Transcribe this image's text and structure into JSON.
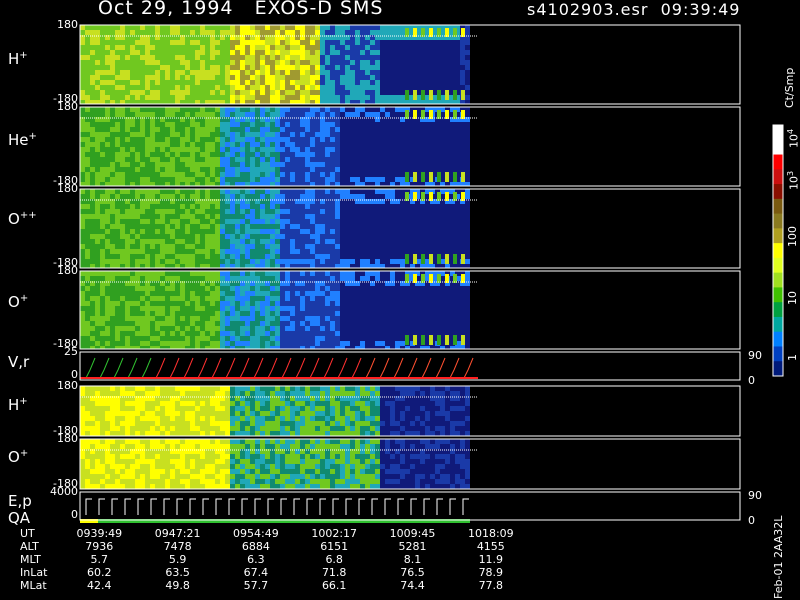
{
  "header": {
    "date_mission": "Oct 29, 1994   EXOS-D SMS",
    "file_time": "s4102903.esr  09:39:49"
  },
  "colorbar": {
    "unit_label": "Ct/Smp",
    "ticks": [
      "10",
      "10",
      "100",
      "10",
      "1"
    ],
    "tick_exponents": [
      "4",
      "3",
      "",
      "",
      ""
    ],
    "colors": [
      "#ffffff",
      "#ffffff",
      "#ff0000",
      "#cc1010",
      "#8a0f00",
      "#7a5a10",
      "#8a7a20",
      "#b0a020",
      "#ffff00",
      "#e0ff20",
      "#a0e020",
      "#40c000",
      "#00a040",
      "#00a8a0",
      "#0080ff",
      "#0040c0",
      "#001a7a"
    ]
  },
  "chart_data": {
    "type": "heatmap",
    "title": "Oct 29, 1994   EXOS-D SMS",
    "x_label": "UT",
    "panels": [
      {
        "name": "H+",
        "ylim": [
          -180,
          180
        ],
        "tick_labels": [
          "180",
          "-180"
        ]
      },
      {
        "name": "He+",
        "ylim": [
          -180,
          180
        ],
        "tick_labels": [
          "180",
          "-180"
        ]
      },
      {
        "name": "O++",
        "ylim": [
          -180,
          180
        ],
        "tick_labels": [
          "180",
          "-180"
        ]
      },
      {
        "name": "O+",
        "ylim": [
          -180,
          180
        ],
        "tick_labels": [
          "180",
          "-180"
        ]
      },
      {
        "name": "V,r",
        "ylim": [
          0,
          25
        ],
        "tick_labels": [
          "25",
          "0"
        ],
        "right_ticks": [
          "90",
          "0"
        ]
      },
      {
        "name": "H+",
        "ylim": [
          -180,
          180
        ],
        "tick_labels": [
          "180",
          "-180"
        ]
      },
      {
        "name": "O+",
        "ylim": [
          -180,
          180
        ],
        "tick_labels": [
          "180",
          "-180"
        ]
      },
      {
        "name": "E,p QA",
        "ylim": [
          0,
          4000
        ],
        "tick_labels": [
          "4000",
          "0"
        ],
        "right_ticks": [
          "90",
          "0"
        ]
      }
    ],
    "ephemeris": {
      "rows": [
        {
          "label": "UT",
          "values": [
            "0939:49",
            "0947:21",
            "0954:49",
            "1002:17",
            "1009:45",
            "1018:09"
          ]
        },
        {
          "label": "ALT",
          "values": [
            "7936",
            "7478",
            "6884",
            "6151",
            "5281",
            "4155"
          ]
        },
        {
          "label": "MLT",
          "values": [
            "5.7",
            "5.9",
            "6.3",
            "6.8",
            "8.1",
            "11.9"
          ]
        },
        {
          "label": "InLat",
          "values": [
            "60.2",
            "63.5",
            "67.4",
            "71.8",
            "76.5",
            "78.9"
          ]
        },
        {
          "label": "MLat",
          "values": [
            "42.4",
            "49.8",
            "57.7",
            "66.1",
            "74.4",
            "77.8"
          ]
        }
      ]
    }
  },
  "side_label": "Feb-01 2AA32L"
}
